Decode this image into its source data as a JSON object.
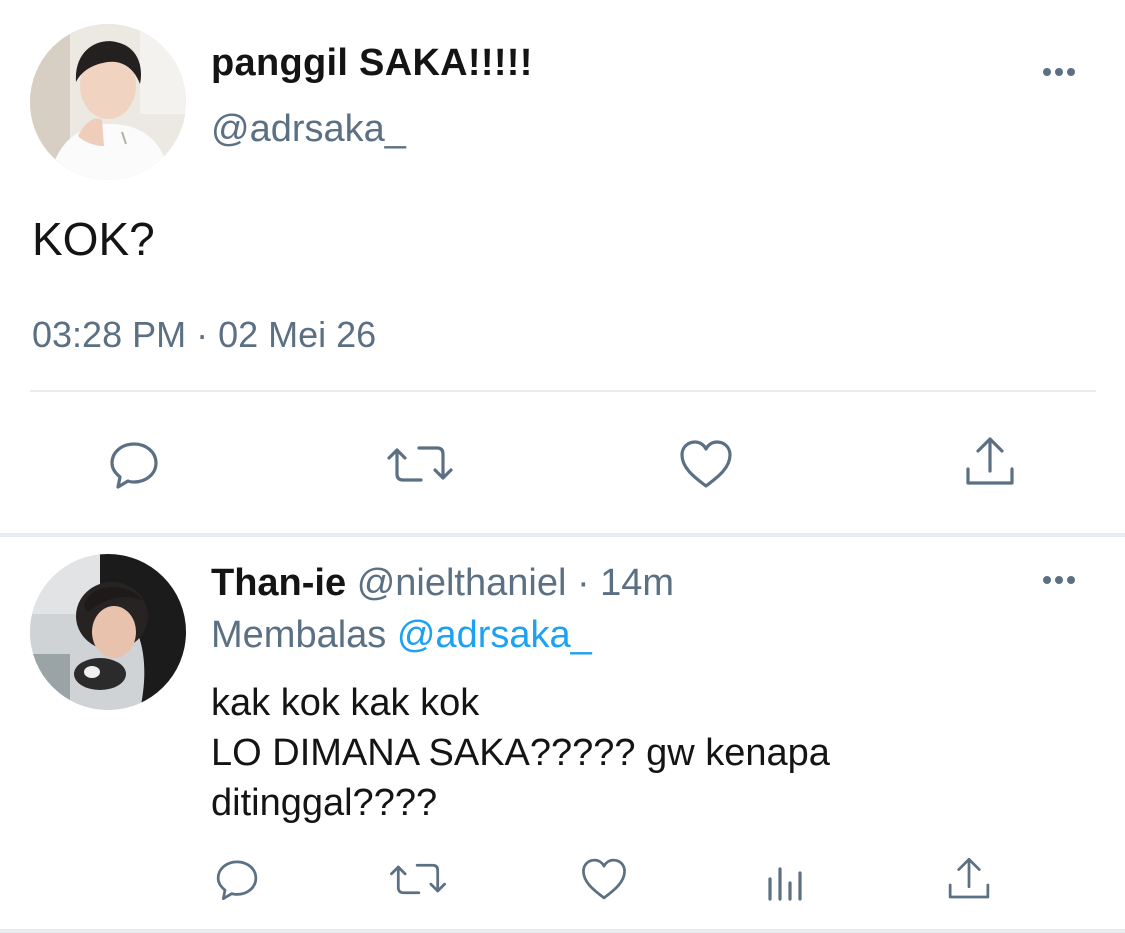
{
  "main_tweet": {
    "display_name": "panggil SAKA!!!!!",
    "handle": "@adrsaka_",
    "text": "KOK?",
    "timestamp": "03:28 PM · 02 Mei 26",
    "more_icon": "more-horizontal-icon",
    "actions": [
      "reply-icon",
      "retweet-icon",
      "like-icon",
      "share-icon"
    ]
  },
  "reply_tweet": {
    "display_name": "Than-ie",
    "handle_time": "@nielthaniel · 14m",
    "replying_label": "Membalas",
    "replying_mention": "@adrsaka_",
    "text_lines": [
      "kak kok kak kok",
      "LO DIMANA SAKA????? gw kenapa",
      "ditinggal????"
    ],
    "more_icon": "more-horizontal-icon",
    "actions": [
      "reply-icon",
      "retweet-icon",
      "like-icon",
      "analytics-icon",
      "share-icon"
    ]
  },
  "colors": {
    "text_primary": "#141414",
    "text_secondary": "#5b7083",
    "link": "#1da1f2",
    "divider": "#e6ecf0"
  }
}
